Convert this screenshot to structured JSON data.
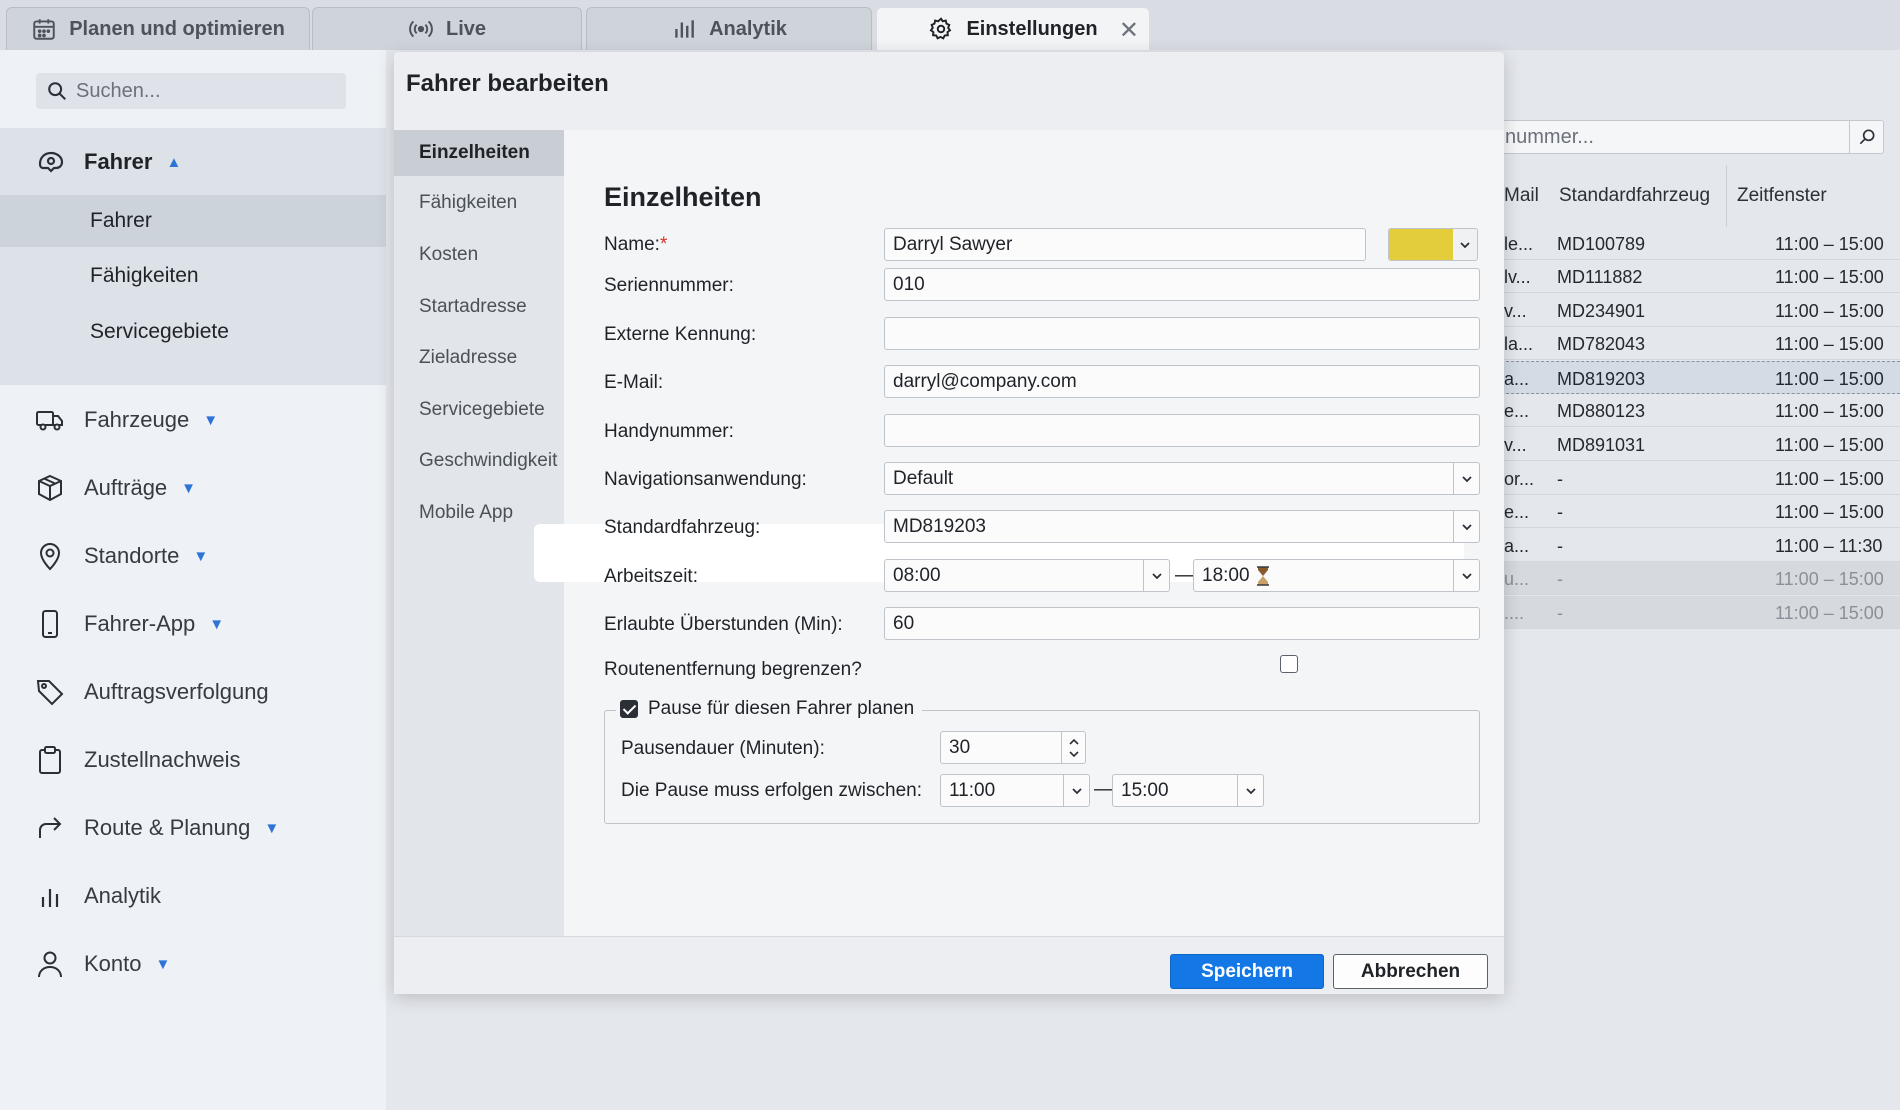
{
  "tabs": [
    {
      "label": "Planen und optimieren",
      "icon": "calendar-icon"
    },
    {
      "label": "Live",
      "icon": "broadcast-icon"
    },
    {
      "label": "Analytik",
      "icon": "bar-chart-icon"
    },
    {
      "label": "Einstellungen",
      "icon": "gear-icon",
      "close": "✕"
    }
  ],
  "sidebar": {
    "search_placeholder": "Suchen...",
    "open_group": {
      "label": "Fahrer",
      "icon": "steering-wheel-icon"
    },
    "subitems": [
      "Fahrer",
      "Fähigkeiten",
      "Servicegebiete"
    ],
    "items": [
      {
        "label": "Fahrzeuge",
        "icon": "truck-icon"
      },
      {
        "label": "Aufträge",
        "icon": "box-icon"
      },
      {
        "label": "Standorte",
        "icon": "location-pin-icon"
      },
      {
        "label": "Fahrer-App",
        "icon": "phone-icon"
      },
      {
        "label": "Auftragsverfolgung",
        "icon": "tag-icon"
      },
      {
        "label": "Zustellnachweis",
        "icon": "clipboard-icon"
      },
      {
        "label": "Route & Planung",
        "icon": "route-arrow-icon"
      },
      {
        "label": "Analytik",
        "icon": "bar-chart-icon"
      },
      {
        "label": "Konto",
        "icon": "user-icon"
      }
    ]
  },
  "background_table": {
    "search_placeholder": "nummer...",
    "headers": [
      "Mail",
      "Standardfahrzeug",
      "Zeitfenster"
    ],
    "rows": [
      [
        "le...",
        "MD100789",
        "11:00 – 15:00"
      ],
      [
        "lv...",
        "MD111882",
        "11:00 – 15:00"
      ],
      [
        "v...",
        "MD234901",
        "11:00 – 15:00"
      ],
      [
        "la...",
        "MD782043",
        "11:00 – 15:00"
      ],
      [
        "a...",
        "MD819203",
        "11:00 – 15:00"
      ],
      [
        "e...",
        "MD880123",
        "11:00 – 15:00"
      ],
      [
        "v...",
        "MD891031",
        "11:00 – 15:00"
      ],
      [
        "or...",
        "-",
        "11:00 – 15:00"
      ],
      [
        "e...",
        "-",
        "11:00 – 15:00"
      ],
      [
        "a...",
        "-",
        "11:00 – 11:30"
      ],
      [
        "u...",
        "-",
        "11:00 – 15:00"
      ],
      [
        "....",
        "-",
        "11:00 – 15:00"
      ]
    ]
  },
  "dialog": {
    "title": "Fahrer bearbeiten",
    "nav": [
      "Einzelheiten",
      "Fähigkeiten",
      "Kosten",
      "Startadresse",
      "Zieladresse",
      "Servicegebiete",
      "Geschwindigkeit",
      "Mobile App"
    ],
    "section_title": "Einzelheiten",
    "fields": {
      "name_label": "Name:",
      "name_required": "*",
      "name_value": "Darryl Sawyer",
      "name_color": "#e3cd3a",
      "serial_label": "Seriennummer:",
      "serial_value": "010",
      "external_id_label": "Externe Kennung:",
      "external_id_value": "",
      "email_label": "E-Mail:",
      "email_value": "darryl@company.com",
      "mobile_label": "Handynummer:",
      "mobile_value": "",
      "nav_app_label": "Navigationsanwendung:",
      "nav_app_value": "Default",
      "default_vehicle_label": "Standardfahrzeug:",
      "default_vehicle_value": "MD819203",
      "worktime_label": "Arbeitszeit:",
      "worktime_start": "08:00",
      "worktime_end": "18:00",
      "range_dash": "—",
      "overtime_label": "Erlaubte Überstunden (Min):",
      "overtime_value": "60",
      "limit_route_label": "Routenentfernung begrenzen?",
      "limit_route_checked": false,
      "break_legend": "Pause für diesen Fahrer planen",
      "break_checked": true,
      "break_duration_label": "Pausendauer (Minuten):",
      "break_duration_value": "30",
      "break_window_label": "Die Pause muss erfolgen zwischen:",
      "break_window_start": "11:00",
      "break_window_end": "15:00"
    },
    "buttons": {
      "save": "Speichern",
      "cancel": "Abbrechen"
    }
  },
  "colors": {
    "accent": "#1477e6",
    "swatch": "#e3cd3a"
  }
}
